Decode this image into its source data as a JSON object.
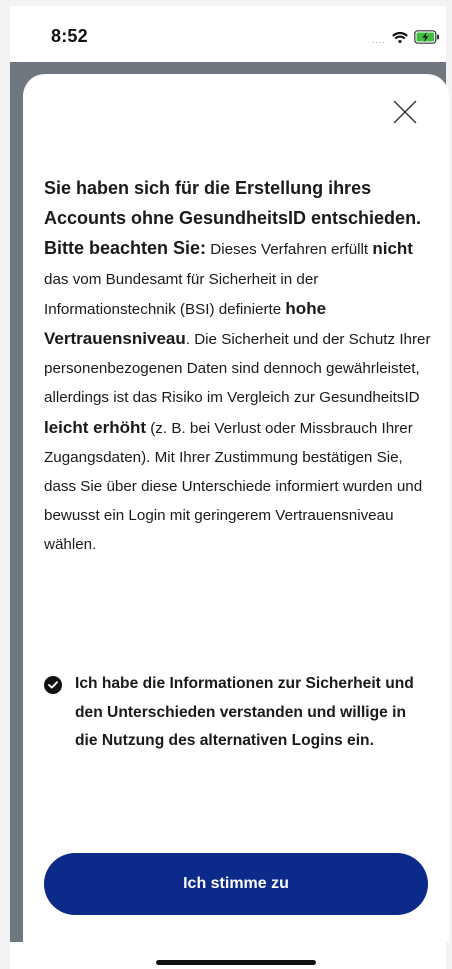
{
  "status_bar": {
    "time": "8:52",
    "signal": "....",
    "icons": [
      "wifi-icon",
      "battery-charging-icon"
    ],
    "battery_color": "#3fbf3f"
  },
  "modal": {
    "close_icon": "close-icon",
    "body": {
      "lead": "Sie haben sich für die Erstellung ihres Accounts ohne GesundheitsID entschieden. Bitte beachten Sie:",
      "p1": " Dieses Verfahren erfüllt ",
      "b1": "nicht",
      "p2": " das vom Bundesamt für Sicherheit in der Informationstechnik (BSI) definierte ",
      "b2": "hohe Vertrauensniveau",
      "p3": ". Die Sicherheit und der Schutz Ihrer personenbezogenen Daten sind dennoch gewährleistet, allerdings ist das Risiko im Vergleich zur GesundheitsID ",
      "b3": "leicht erhöht",
      "p4": " (z. B. bei Verlust oder Missbrauch Ihrer Zugangsdaten). Mit Ihrer Zustimmung bestätigen Sie, dass Sie über diese Unterschiede informiert wurden und bewusst ein Login mit geringerem Vertrauensniveau wählen."
    },
    "consent": {
      "checked": true,
      "label": "Ich habe die Informationen zur Sicherheit und den Unterschieden verstanden und willige in die Nutzung des alternativen Logins ein."
    },
    "agree_button": "Ich stimme zu"
  },
  "colors": {
    "primary": "#0b2a8a",
    "backdrop": "#70777f",
    "text": "#1a1a1a"
  }
}
